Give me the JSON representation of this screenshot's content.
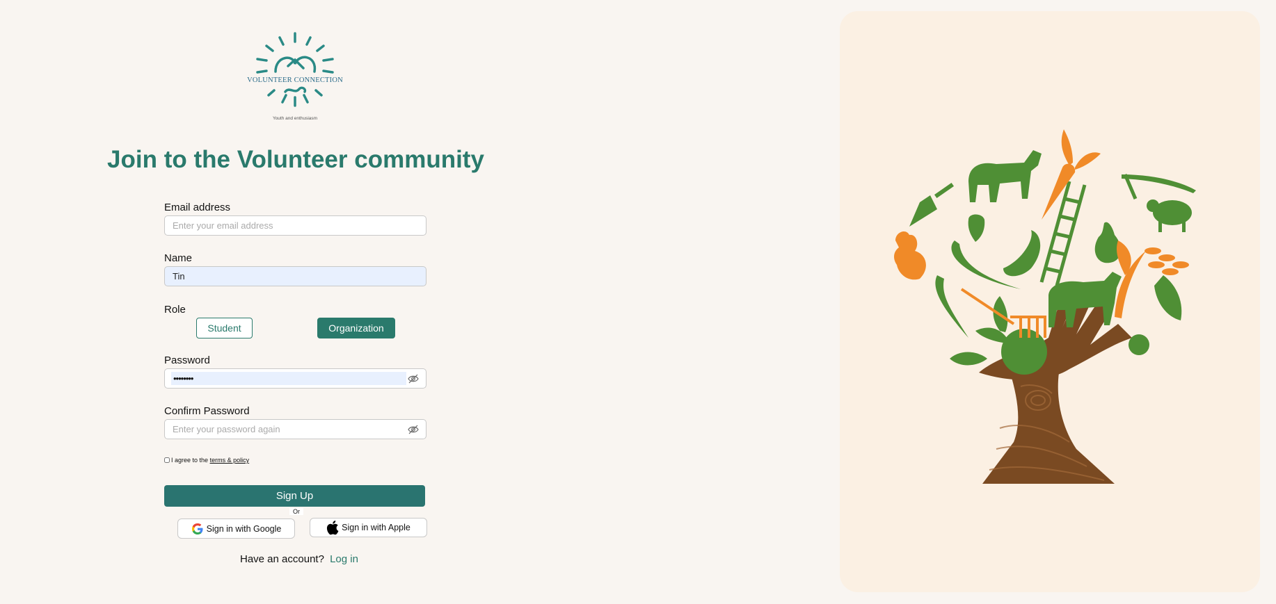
{
  "brand": {
    "logo_name": "VOLUNTEER CONNECTION",
    "logo_tagline": "Youth and enthusiasm",
    "logo_color": "#2a8a86"
  },
  "page_title": "Join to the Volunteer community",
  "form": {
    "email": {
      "label": "Email address",
      "placeholder": "Enter your email address",
      "value": ""
    },
    "name": {
      "label": "Name",
      "placeholder": "",
      "value": "Tin"
    },
    "role": {
      "label": "Role",
      "options": [
        "Student",
        "Organization"
      ],
      "selected": "Organization"
    },
    "password": {
      "label": "Password",
      "masked_value": "••••••••"
    },
    "confirm_password": {
      "label": "Confirm Password",
      "placeholder": "Enter your password again"
    },
    "agree": {
      "prefix": "I agree to the",
      "link": "terms & policy",
      "checked": false
    },
    "signup_label": "Sign Up",
    "or_label": "Or",
    "google_label": "Sign in with Google",
    "apple_label": "Sign in with Apple",
    "have_account": "Have an account?",
    "login_label": "Log in"
  },
  "colors": {
    "accent": "#2a7a6c",
    "panel_bg": "#fbf0e3",
    "page_bg": "#f9f5f1",
    "illustration_green": "#4f8f35",
    "illustration_orange": "#f08a28",
    "trunk_brown": "#7a4a22"
  },
  "illustration": {
    "icon": "agriculture-tree-hand-illustration"
  }
}
